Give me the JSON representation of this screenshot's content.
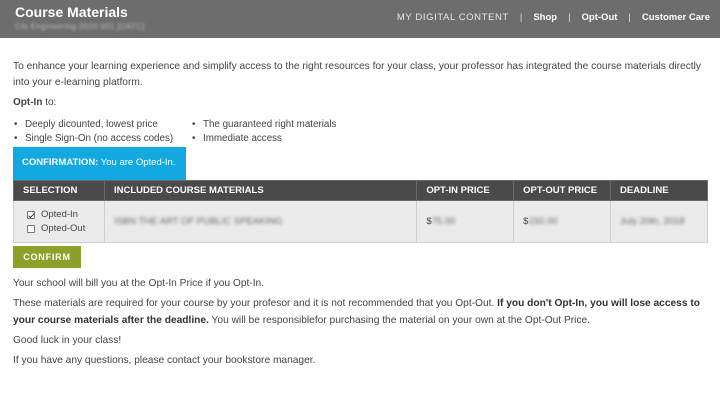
{
  "header": {
    "title": "Course Materials",
    "subtitle": "CIs Engineering 2020 001 [UATC]",
    "nav": [
      "MY DIGITAL CONTENT",
      "Shop",
      "Opt-Out",
      "Customer Care"
    ],
    "bg_color": "#6d6d6d"
  },
  "intro": "To enhance your learning experience and simplify access to the right resources for your class, your professor has integrated the course materials directly into your e-learning platform.",
  "optin": {
    "label_bold": "Opt-In",
    "label_rest": " to:",
    "bullets_left": [
      "Deeply dicounted, lowest price",
      "Single Sign-On (no access codes)"
    ],
    "bullets_right": [
      "The guaranteed right materials",
      "Immediate access"
    ]
  },
  "confirmation": {
    "label": "CONFIRMATION:",
    "status": " You are Opted-In.",
    "color": "#12a8e0"
  },
  "table": {
    "headers": [
      "SELECTION",
      "INCLUDED COURSE MATERIALS",
      "OPT-IN PRICE",
      "OPT-OUT PRICE",
      "DEADLINE"
    ],
    "options": [
      {
        "label": "Opted-In",
        "checked": true
      },
      {
        "label": "Opted-Out",
        "checked": false
      }
    ],
    "material": "ISBN THE ART OF PUBLIC SPEAKING",
    "optin_currency": "$",
    "optin_price": "75.00",
    "optout_currency": "$",
    "optout_price": "150.00",
    "deadline": "July 20th, 2018"
  },
  "confirm_button": {
    "label": "CONFIRM",
    "color": "#8ea02a"
  },
  "paragraphs": {
    "billing": "Your school will bill you at the Opt-In Price if you Opt-In.",
    "required_pre": "These materials are required for your course by your profesor and it is not recommended that you Opt-Out. ",
    "required_bold": "If you don't Opt-In, you will lose access to your course materials after the deadline.",
    "required_post": " You will be responsiblefor purchasing the material on your own at the Opt-Out Price.",
    "luck": "Good luck in your class!",
    "questions": "If you have any questions, please contact your bookstore manager."
  }
}
